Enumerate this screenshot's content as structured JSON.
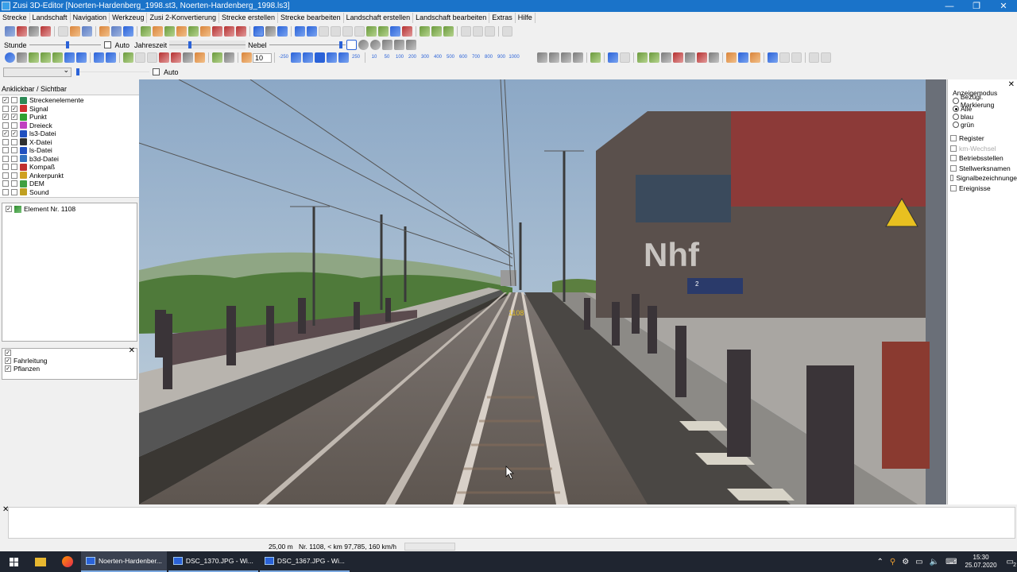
{
  "window": {
    "title": "Zusi 3D-Editor [Noerten-Hardenberg_1998.st3, Noerten-Hardenberg_1998.ls3]",
    "minimize": "—",
    "maximize": "❐",
    "close": "✕"
  },
  "menu": [
    "Strecke",
    "Landschaft",
    "Navigation",
    "Werkzeug",
    "Zusi 2-Konvertierung",
    "Strecke erstellen",
    "Strecke bearbeiten",
    "Landschaft erstellen",
    "Landschaft bearbeiten",
    "Extras",
    "Hilfe"
  ],
  "toolbar2": {
    "stunde_label": "Stunde",
    "auto_label": "Auto",
    "jahreszeit_label": "Jahreszeit",
    "nebel_label": "Nebel",
    "spin_value": "10"
  },
  "toolbar3": {
    "zoom_steps": [
      "-250",
      "10",
      "50",
      "100",
      "200",
      "300",
      "400",
      "500",
      "600",
      "700",
      "800",
      "900",
      "1000"
    ],
    "step_plus": "250"
  },
  "toolbar4": {
    "auto_label": "Auto"
  },
  "left_panel": {
    "title": "Anklickbar / Sichtbar",
    "layers": [
      {
        "label": "Streckenelemente",
        "c1": "✓",
        "c2": "",
        "color": "#2e8b57"
      },
      {
        "label": "Signal",
        "c1": "",
        "c2": "✓",
        "color": "#d03030"
      },
      {
        "label": "Punkt",
        "c1": "✓",
        "c2": "✓",
        "color": "#30a030"
      },
      {
        "label": "Dreieck",
        "c1": "",
        "c2": "",
        "color": "#c040c0"
      },
      {
        "label": "ls3-Datei",
        "c1": "✓",
        "c2": "✓",
        "color": "#2050c0"
      },
      {
        "label": "X-Datei",
        "c1": "",
        "c2": "",
        "color": "#303030"
      },
      {
        "label": "ls-Datei",
        "c1": "",
        "c2": "",
        "color": "#2050c0"
      },
      {
        "label": "b3d-Datei",
        "c1": "",
        "c2": "",
        "color": "#3070c0"
      },
      {
        "label": "Kompaß",
        "c1": "",
        "c2": "",
        "color": "#c03030"
      },
      {
        "label": "Ankerpunkt",
        "c1": "",
        "c2": "",
        "color": "#d0a020"
      },
      {
        "label": "DEM",
        "c1": "",
        "c2": "",
        "color": "#40a040"
      },
      {
        "label": "Sound",
        "c1": "",
        "c2": "",
        "color": "#c0a020"
      }
    ],
    "tree_item": "Element Nr. 1108",
    "tree_item_check": "✓",
    "sub_items": [
      {
        "label": "",
        "check": "✓"
      },
      {
        "label": "Fahrleitung",
        "check": "✓"
      },
      {
        "label": "Pflanzen",
        "check": "✓"
      }
    ]
  },
  "scene": {
    "marker_label": "1108",
    "sign_text": "Nhf",
    "platform_sign": "2"
  },
  "right_panel": {
    "heading": "Anzeigemodus",
    "radios": [
      {
        "label": "Bezügl. Markierung",
        "on": false
      },
      {
        "label": "Alle",
        "on": true
      },
      {
        "label": "blau",
        "on": false
      },
      {
        "label": "grün",
        "on": false
      }
    ],
    "checks": [
      {
        "label": "Register",
        "disabled": false
      },
      {
        "label": "km-Wechsel",
        "disabled": true
      },
      {
        "label": "Betriebsstellen",
        "disabled": false
      },
      {
        "label": "Stellwerksnamen",
        "disabled": false
      },
      {
        "label": "Signalbezeichnunge",
        "disabled": false
      },
      {
        "label": "Ereignisse",
        "disabled": false
      }
    ]
  },
  "status": {
    "distance": "25,00 m",
    "element_info": "Nr. 1108, < km 97,785, 160 km/h"
  },
  "taskbar": {
    "apps": [
      {
        "label": "Noerten-Hardenber...",
        "active": true
      },
      {
        "label": "DSC_1370.JPG - Wi...",
        "active": false
      },
      {
        "label": "DSC_1367.JPG - Wi...",
        "active": false
      }
    ],
    "time": "15:30",
    "date": "25.07.2020",
    "notifications": "2"
  }
}
